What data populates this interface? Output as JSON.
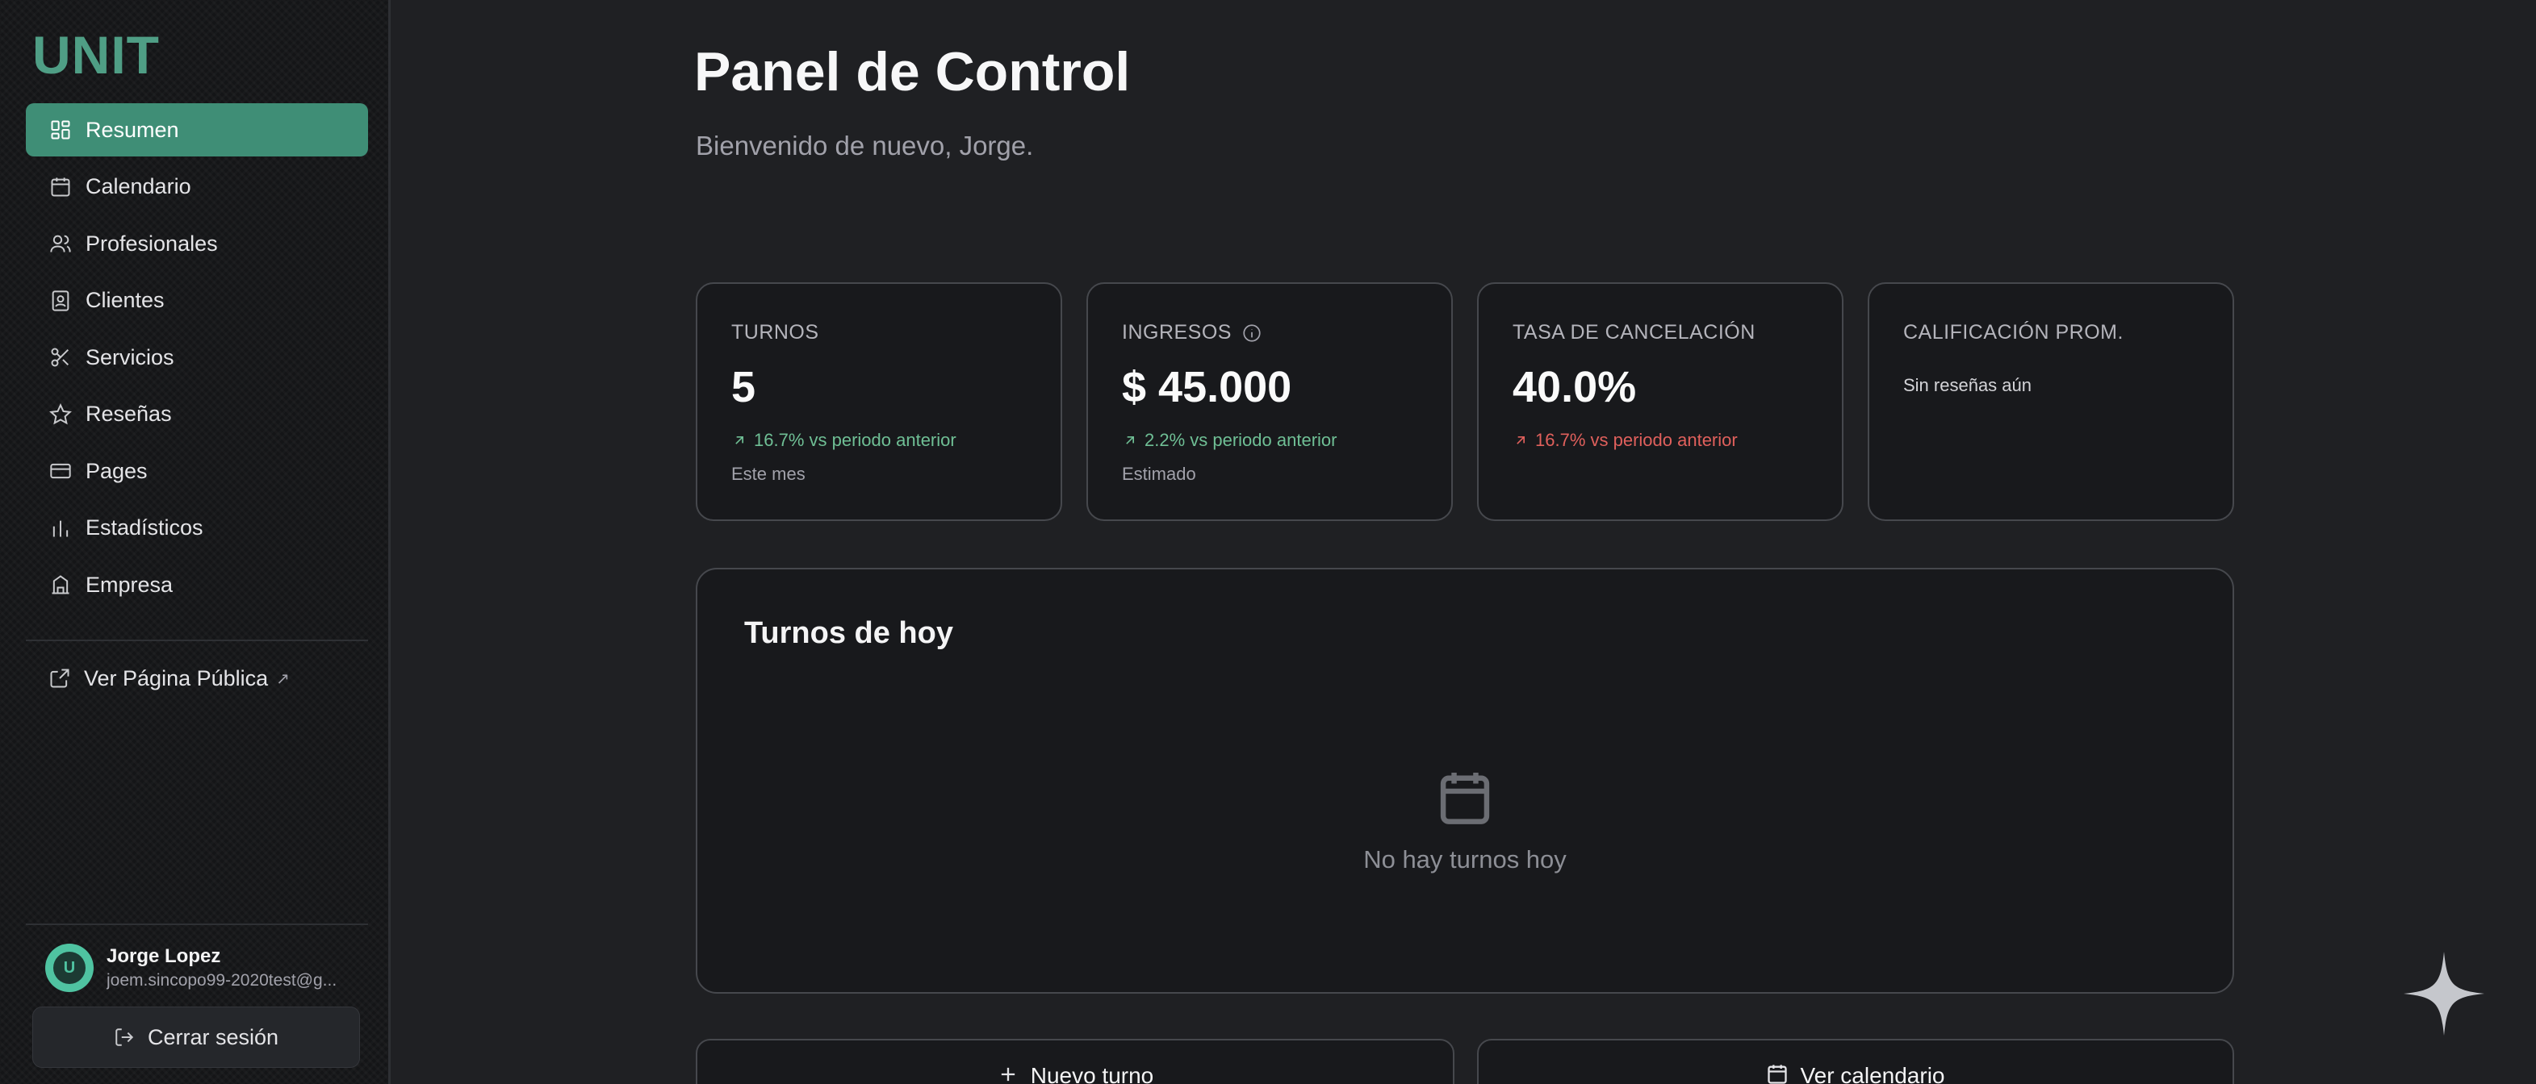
{
  "app": {
    "logo": "UNIT"
  },
  "sidebar": {
    "items": [
      {
        "label": "Resumen",
        "icon": "layout-grid-icon",
        "active": true
      },
      {
        "label": "Calendario",
        "icon": "calendar-icon"
      },
      {
        "label": "Profesionales",
        "icon": "users-icon"
      },
      {
        "label": "Clientes",
        "icon": "contact-card-icon"
      },
      {
        "label": "Servicios",
        "icon": "scissors-icon"
      },
      {
        "label": "Reseñas",
        "icon": "star-icon"
      },
      {
        "label": "Pages",
        "icon": "credit-card-icon"
      },
      {
        "label": "Estadísticos",
        "icon": "bar-chart-icon"
      },
      {
        "label": "Empresa",
        "icon": "building-icon"
      }
    ],
    "public_link": {
      "label": "Ver Página Pública",
      "caret": "↗"
    },
    "user": {
      "name": "Jorge Lopez",
      "email": "joem.sincopo99-2020test@g...",
      "avatar_initial": "U"
    },
    "logout_label": "Cerrar sesión"
  },
  "header": {
    "title": "Panel de Control",
    "subtitle": "Bienvenido de nuevo, Jorge."
  },
  "stats": [
    {
      "label": "TURNOS",
      "value": "5",
      "trend": "16.7% vs periodo anterior",
      "trend_direction": "up",
      "note": "Este mes"
    },
    {
      "label": "INGRESOS",
      "has_info": true,
      "value": "$ 45.000",
      "trend": "2.2% vs periodo anterior",
      "trend_direction": "up",
      "note": "Estimado"
    },
    {
      "label": "TASA DE CANCELACIÓN",
      "value": "40.0%",
      "trend": "16.7% vs periodo anterior",
      "trend_direction": "down"
    },
    {
      "label": "CALIFICACIÓN PROM.",
      "empty": "Sin reseñas aún"
    }
  ],
  "today": {
    "title": "Turnos de hoy",
    "empty_text": "No hay turnos hoy"
  },
  "actions": {
    "new_appointment": "Nuevo turno",
    "view_calendar": "Ver calendario"
  },
  "colors": {
    "accent": "#3f8e76",
    "logo": "#4f9e85",
    "trend_up": "#6fbf95",
    "trend_down": "#e0605c",
    "background": "#1f2023"
  }
}
